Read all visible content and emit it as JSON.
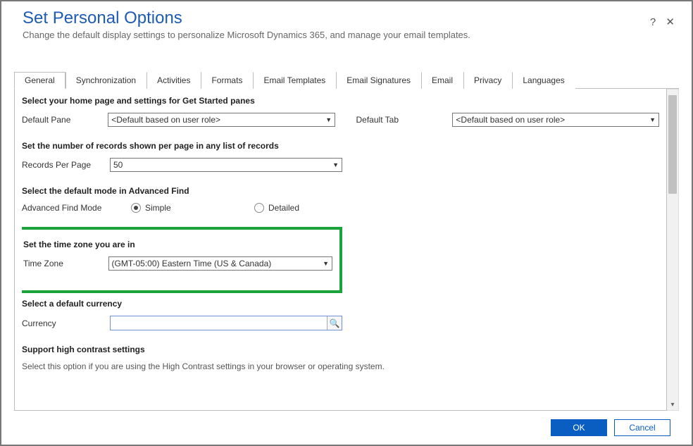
{
  "header": {
    "title": "Set Personal Options",
    "subtitle": "Change the default display settings to personalize Microsoft Dynamics 365, and manage your email templates.",
    "help_icon": "?",
    "close_icon": "✕"
  },
  "tabs": [
    "General",
    "Synchronization",
    "Activities",
    "Formats",
    "Email Templates",
    "Email Signatures",
    "Email",
    "Privacy",
    "Languages"
  ],
  "active_tab_index": 0,
  "sections": {
    "home_page": {
      "title": "Select your home page and settings for Get Started panes",
      "default_pane_label": "Default Pane",
      "default_pane_value": "<Default based on user role>",
      "default_tab_label": "Default Tab",
      "default_tab_value": "<Default based on user role>"
    },
    "records_per_page": {
      "title": "Set the number of records shown per page in any list of records",
      "label": "Records Per Page",
      "value": "50"
    },
    "advanced_find": {
      "title": "Select the default mode in Advanced Find",
      "label": "Advanced Find Mode",
      "option_simple": "Simple",
      "option_detailed": "Detailed",
      "selected": "simple"
    },
    "timezone": {
      "title": "Set the time zone you are in",
      "label": "Time Zone",
      "value": "(GMT-05:00) Eastern Time (US & Canada)"
    },
    "currency": {
      "title": "Select a default currency",
      "label": "Currency",
      "value": ""
    },
    "high_contrast": {
      "title": "Support high contrast settings",
      "note": "Select this option if you are using the High Contrast settings in your browser or operating system."
    }
  },
  "footer": {
    "ok": "OK",
    "cancel": "Cancel"
  },
  "caret": "▼",
  "lookup_icon": "🔍"
}
